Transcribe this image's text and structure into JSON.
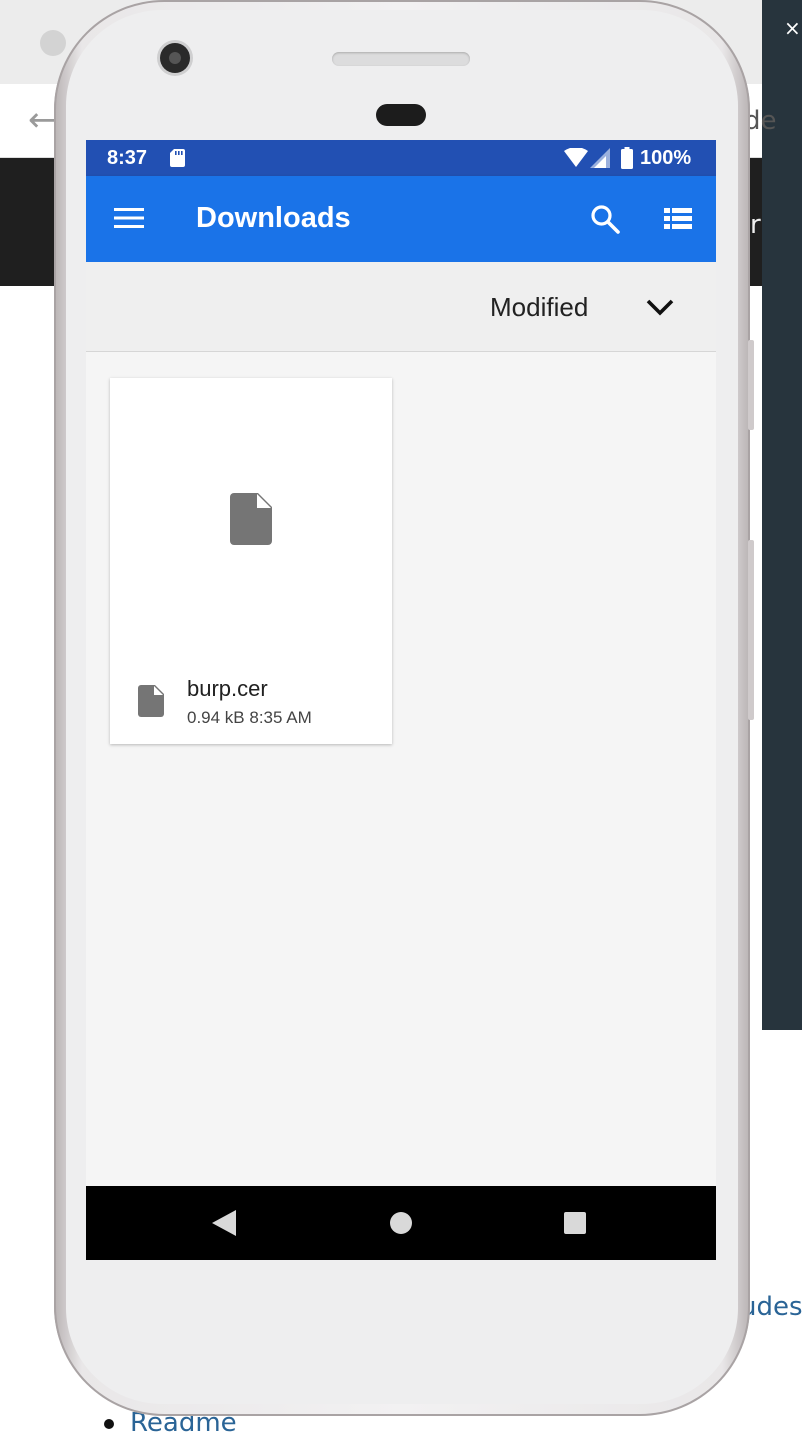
{
  "background_page": {
    "close_glyph": "×",
    "back_glyph": "←",
    "fragment_top": "de",
    "fragment_mid": "r",
    "fragment_bottom": "udes",
    "readme_link": "Readme"
  },
  "status_bar": {
    "time": "8:37",
    "battery": "100%",
    "icons": [
      "sd-card-icon",
      "wifi-icon",
      "cell-signal-icon",
      "battery-icon"
    ]
  },
  "app_bar": {
    "title": "Downloads",
    "icons": [
      "hamburger-menu-icon",
      "search-icon",
      "list-view-icon"
    ]
  },
  "sort": {
    "label": "Modified",
    "icon": "chevron-down-icon"
  },
  "files": [
    {
      "name": "burp.cer",
      "meta": "0.94 kB 8:35 AM",
      "icon": "file-icon"
    }
  ],
  "nav_bar": {
    "buttons": [
      "back-triangle-icon",
      "home-circle-icon",
      "recents-square-icon"
    ]
  },
  "colors": {
    "status_bar": "#2250b3",
    "app_bar": "#1a73e8",
    "screen_bg": "#f5f5f5",
    "sort_bar_bg": "#efefef",
    "file_icon": "#757575",
    "nav_bar": "#000000",
    "link": "#2a6496"
  }
}
